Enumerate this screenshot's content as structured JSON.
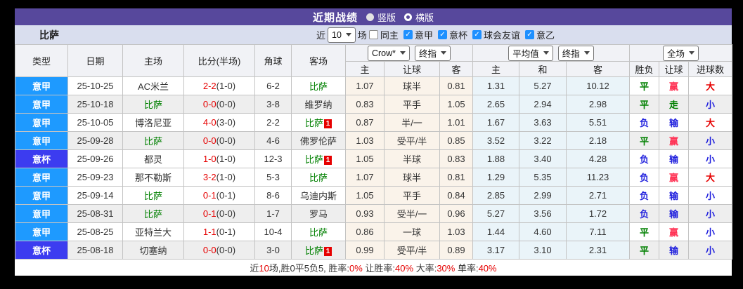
{
  "colors": {
    "red": "#e60000",
    "green": "#008000",
    "blue": "#2020dd",
    "winred": "#ff3355",
    "text_dark": "#333333",
    "team_green": "#008000",
    "serie_a_badge": "#1e9aff",
    "coppa_badge": "#3c3cf0",
    "accent_purple": "#57489c",
    "filter_bar_bg": "#d9deee",
    "checkbox_blue": "#1e90ff"
  },
  "title_bar": {
    "title": "近期战绩",
    "radios": [
      {
        "label": "竖版",
        "selected": true
      },
      {
        "label": "横版",
        "selected": false
      }
    ]
  },
  "filter_bar": {
    "team": "比萨",
    "near_label": "近",
    "count_value": "10",
    "games_label": "场",
    "checkboxes": [
      {
        "label": "同主",
        "checked": false
      },
      {
        "label": "意甲",
        "checked": true
      },
      {
        "label": "意杯",
        "checked": true
      },
      {
        "label": "球会友谊",
        "checked": true
      },
      {
        "label": "意乙",
        "checked": true
      }
    ]
  },
  "table": {
    "headers": {
      "static": [
        "类型",
        "日期",
        "主场",
        "比分(半场)",
        "角球",
        "客场"
      ],
      "odds_group": {
        "selects": [
          "Crow*",
          "终指"
        ],
        "cols": [
          "主",
          "让球",
          "客"
        ]
      },
      "avg_group": {
        "selects": [
          "平均值",
          "终指"
        ],
        "cols": [
          "主",
          "和",
          "客"
        ]
      },
      "result_group": {
        "selects": [
          "全场"
        ],
        "cols": [
          "胜负",
          "让球",
          "进球数"
        ]
      }
    },
    "rows": [
      {
        "league": "意甲",
        "badge_color": "#1e9aff",
        "date": "25-10-25",
        "home": "AC米兰",
        "home_green": false,
        "score_ft": "2-2",
        "score_ht": "(1-0)",
        "corners": "6-2",
        "away": "比萨",
        "away_green": true,
        "away_rc": 0,
        "odds_home": "1.07",
        "handicap": "球半",
        "odds_away": "0.81",
        "avg_home": "1.31",
        "avg_draw": "5.27",
        "avg_away": "10.12",
        "result": "平",
        "result_color": "green",
        "handicap_result": "赢",
        "handicap_result_color": "winred",
        "goals": "大",
        "goals_color": "red",
        "stripe": false
      },
      {
        "league": "意甲",
        "badge_color": "#1e9aff",
        "date": "25-10-18",
        "home": "比萨",
        "home_green": true,
        "score_ft": "0-0",
        "score_ht": "(0-0)",
        "corners": "3-8",
        "away": "维罗纳",
        "away_green": false,
        "away_rc": 0,
        "odds_home": "0.83",
        "handicap": "平手",
        "odds_away": "1.05",
        "avg_home": "2.65",
        "avg_draw": "2.94",
        "avg_away": "2.98",
        "result": "平",
        "result_color": "green",
        "handicap_result": "走",
        "handicap_result_color": "green",
        "goals": "小",
        "goals_color": "blue",
        "stripe": true
      },
      {
        "league": "意甲",
        "badge_color": "#1e9aff",
        "date": "25-10-05",
        "home": "博洛尼亚",
        "home_green": false,
        "score_ft": "4-0",
        "score_ht": "(3-0)",
        "corners": "2-2",
        "away": "比萨",
        "away_green": true,
        "away_rc": 1,
        "odds_home": "0.87",
        "handicap": "半/一",
        "odds_away": "1.01",
        "avg_home": "1.67",
        "avg_draw": "3.63",
        "avg_away": "5.51",
        "result": "负",
        "result_color": "blue",
        "handicap_result": "输",
        "handicap_result_color": "blue",
        "goals": "大",
        "goals_color": "red",
        "stripe": false
      },
      {
        "league": "意甲",
        "badge_color": "#1e9aff",
        "date": "25-09-28",
        "home": "比萨",
        "home_green": true,
        "score_ft": "0-0",
        "score_ht": "(0-0)",
        "corners": "4-6",
        "away": "佛罗伦萨",
        "away_green": false,
        "away_rc": 0,
        "odds_home": "1.03",
        "handicap": "受平/半",
        "odds_away": "0.85",
        "avg_home": "3.52",
        "avg_draw": "3.22",
        "avg_away": "2.18",
        "result": "平",
        "result_color": "green",
        "handicap_result": "赢",
        "handicap_result_color": "winred",
        "goals": "小",
        "goals_color": "blue",
        "stripe": true
      },
      {
        "league": "意杯",
        "badge_color": "#3c3cf0",
        "date": "25-09-26",
        "home": "都灵",
        "home_green": false,
        "score_ft": "1-0",
        "score_ht": "(1-0)",
        "corners": "12-3",
        "away": "比萨",
        "away_green": true,
        "away_rc": 1,
        "odds_home": "1.05",
        "handicap": "半球",
        "odds_away": "0.83",
        "avg_home": "1.88",
        "avg_draw": "3.40",
        "avg_away": "4.28",
        "result": "负",
        "result_color": "blue",
        "handicap_result": "输",
        "handicap_result_color": "blue",
        "goals": "小",
        "goals_color": "blue",
        "stripe": false
      },
      {
        "league": "意甲",
        "badge_color": "#1e9aff",
        "date": "25-09-23",
        "home": "那不勒斯",
        "home_green": false,
        "score_ft": "3-2",
        "score_ht": "(1-0)",
        "corners": "5-3",
        "away": "比萨",
        "away_green": true,
        "away_rc": 0,
        "odds_home": "1.07",
        "handicap": "球半",
        "odds_away": "0.81",
        "avg_home": "1.29",
        "avg_draw": "5.35",
        "avg_away": "11.23",
        "result": "负",
        "result_color": "blue",
        "handicap_result": "赢",
        "handicap_result_color": "winred",
        "goals": "大",
        "goals_color": "red",
        "stripe": false
      },
      {
        "league": "意甲",
        "badge_color": "#1e9aff",
        "date": "25-09-14",
        "home": "比萨",
        "home_green": true,
        "score_ft": "0-1",
        "score_ht": "(0-1)",
        "corners": "8-6",
        "away": "乌迪内斯",
        "away_green": false,
        "away_rc": 0,
        "odds_home": "1.05",
        "handicap": "平手",
        "odds_away": "0.84",
        "avg_home": "2.85",
        "avg_draw": "2.99",
        "avg_away": "2.71",
        "result": "负",
        "result_color": "blue",
        "handicap_result": "输",
        "handicap_result_color": "blue",
        "goals": "小",
        "goals_color": "blue",
        "stripe": false
      },
      {
        "league": "意甲",
        "badge_color": "#1e9aff",
        "date": "25-08-31",
        "home": "比萨",
        "home_green": true,
        "score_ft": "0-1",
        "score_ht": "(0-0)",
        "corners": "1-7",
        "away": "罗马",
        "away_green": false,
        "away_rc": 0,
        "odds_home": "0.93",
        "handicap": "受半/一",
        "odds_away": "0.96",
        "avg_home": "5.27",
        "avg_draw": "3.56",
        "avg_away": "1.72",
        "result": "负",
        "result_color": "blue",
        "handicap_result": "输",
        "handicap_result_color": "blue",
        "goals": "小",
        "goals_color": "blue",
        "stripe": true
      },
      {
        "league": "意甲",
        "badge_color": "#1e9aff",
        "date": "25-08-25",
        "home": "亚特兰大",
        "home_green": false,
        "score_ft": "1-1",
        "score_ht": "(0-1)",
        "corners": "10-4",
        "away": "比萨",
        "away_green": true,
        "away_rc": 0,
        "odds_home": "0.86",
        "handicap": "一球",
        "odds_away": "1.03",
        "avg_home": "1.44",
        "avg_draw": "4.60",
        "avg_away": "7.11",
        "result": "平",
        "result_color": "green",
        "handicap_result": "赢",
        "handicap_result_color": "winred",
        "goals": "小",
        "goals_color": "blue",
        "stripe": false
      },
      {
        "league": "意杯",
        "badge_color": "#3c3cf0",
        "date": "25-08-18",
        "home": "切塞纳",
        "home_green": false,
        "score_ft": "0-0",
        "score_ht": "(0-0)",
        "corners": "3-0",
        "away": "比萨",
        "away_green": true,
        "away_rc": 1,
        "odds_home": "0.99",
        "handicap": "受平/半",
        "odds_away": "0.89",
        "avg_home": "3.17",
        "avg_draw": "3.10",
        "avg_away": "2.31",
        "result": "平",
        "result_color": "green",
        "handicap_result": "输",
        "handicap_result_color": "blue",
        "goals": "小",
        "goals_color": "blue",
        "stripe": true
      }
    ]
  },
  "summary": {
    "segments": [
      {
        "text": "近",
        "red": false
      },
      {
        "text": "10",
        "red": true
      },
      {
        "text": "场,胜0平5负5, 胜率:",
        "red": false
      },
      {
        "text": "0%",
        "red": true
      },
      {
        "text": " 让胜率:",
        "red": false
      },
      {
        "text": "40%",
        "red": true
      },
      {
        "text": " 大率:",
        "red": false
      },
      {
        "text": "30%",
        "red": true
      },
      {
        "text": " 单率:",
        "red": false
      },
      {
        "text": "40%",
        "red": true
      }
    ]
  }
}
